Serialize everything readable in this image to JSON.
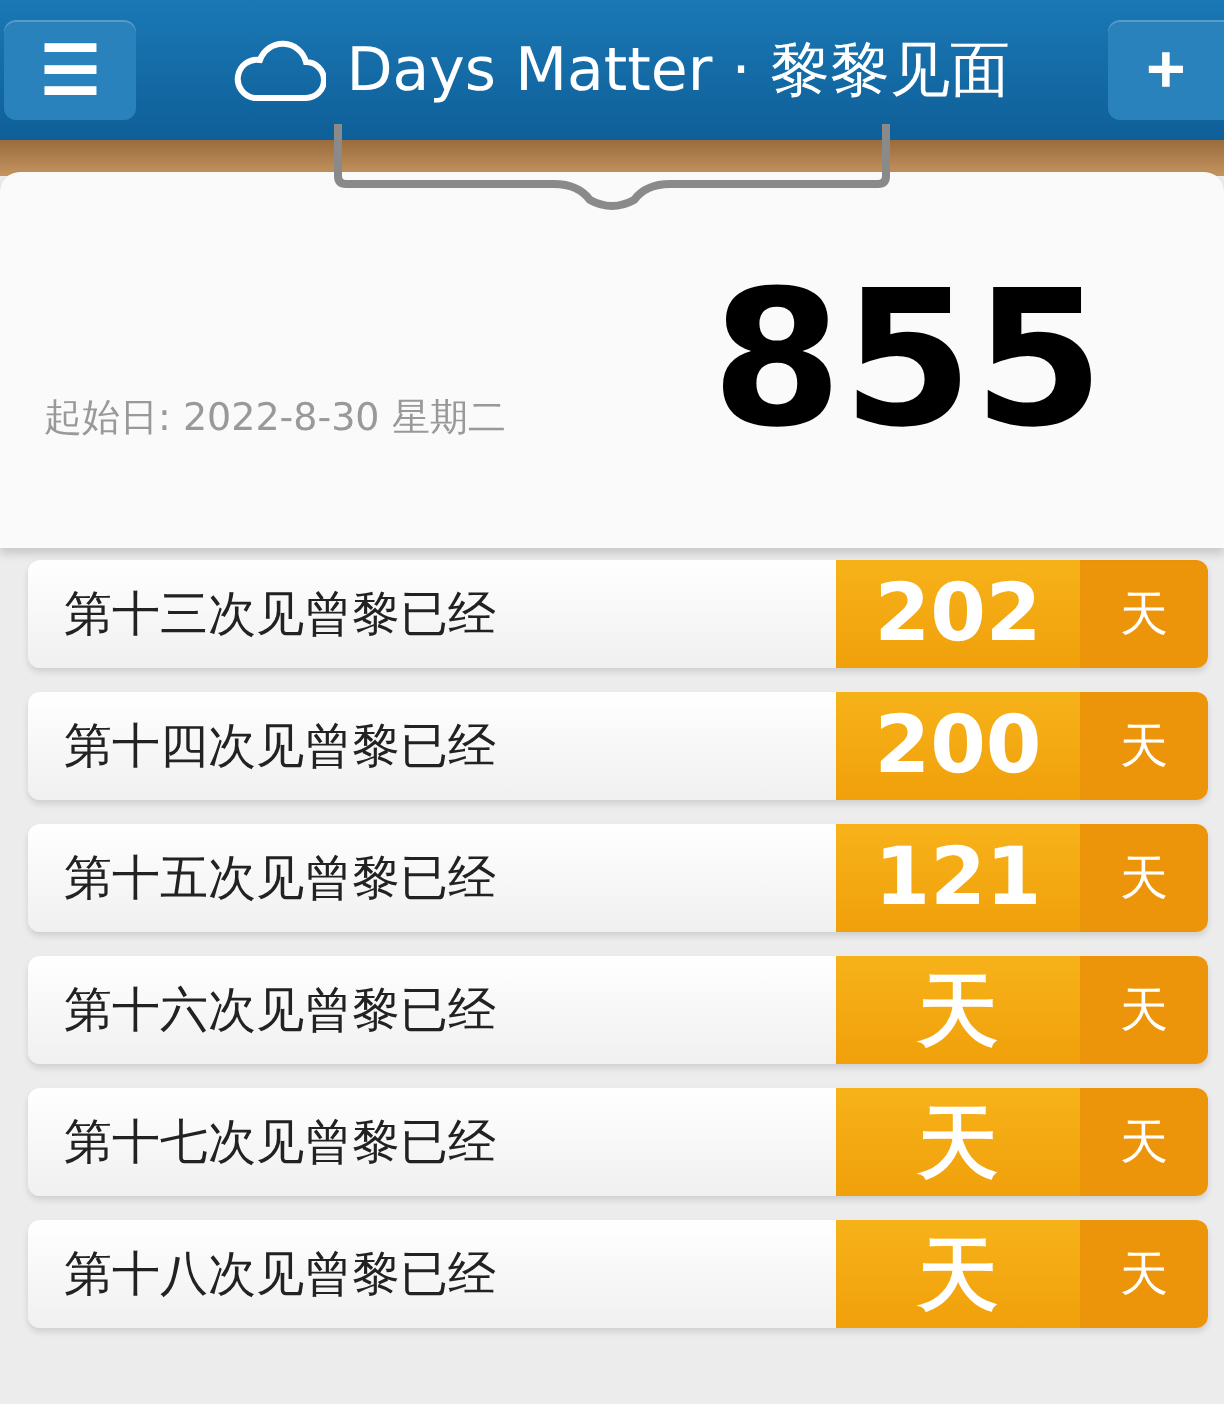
{
  "header": {
    "menu_icon": "☰",
    "title": "Days Matter · 黎黎见面",
    "add_icon": "+"
  },
  "summary": {
    "start_date": "起始日: 2022-8-30 星期二",
    "days": "855"
  },
  "events": [
    {
      "label": "第十三次见曾黎已经",
      "count": "202",
      "unit": "天"
    },
    {
      "label": "第十四次见曾黎已经",
      "count": "200",
      "unit": "天"
    },
    {
      "label": "第十五次见曾黎已经",
      "count": "121",
      "unit": "天"
    },
    {
      "label": "第十六次见曾黎已经",
      "count": "天",
      "unit": "天"
    },
    {
      "label": "第十七次见曾黎已经",
      "count": "天",
      "unit": "天"
    },
    {
      "label": "第十八次见曾黎已经",
      "count": "天",
      "unit": "天"
    }
  ]
}
